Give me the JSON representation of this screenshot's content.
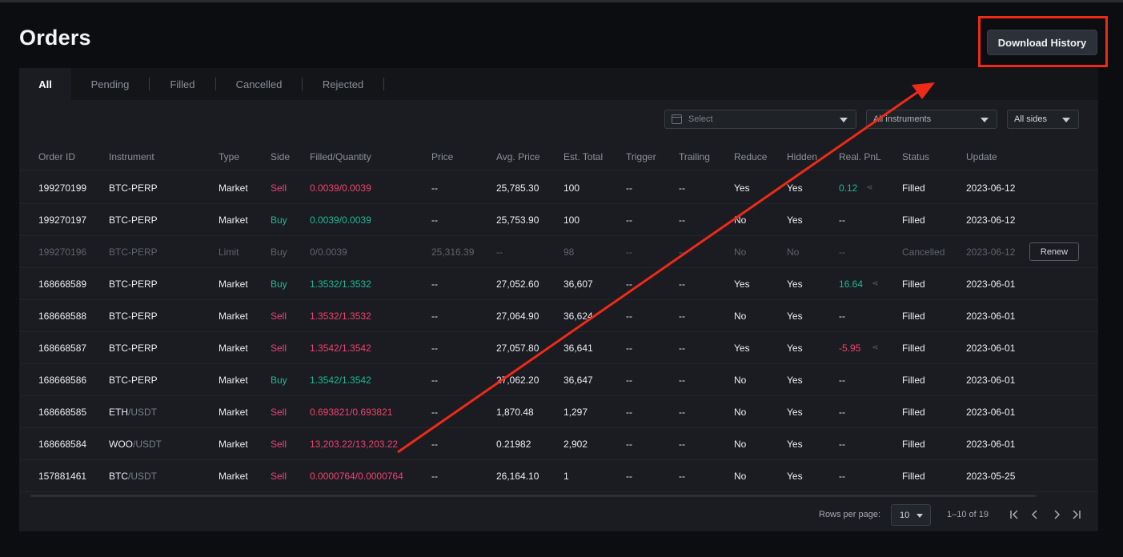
{
  "page": {
    "title": "Orders"
  },
  "header": {
    "download_label": "Download History"
  },
  "tabs": [
    {
      "label": "All",
      "active": true
    },
    {
      "label": "Pending",
      "active": false
    },
    {
      "label": "Filled",
      "active": false
    },
    {
      "label": "Cancelled",
      "active": false
    },
    {
      "label": "Rejected",
      "active": false
    }
  ],
  "filters": {
    "date": {
      "placeholder": "Select",
      "icon": "calendar-icon"
    },
    "instrument": {
      "value": "All instruments"
    },
    "side": {
      "value": "All sides"
    }
  },
  "columns": [
    "Order ID",
    "Instrument",
    "Type",
    "Side",
    "Filled/Quantity",
    "Price",
    "Avg. Price",
    "Est. Total",
    "Trigger",
    "Trailing",
    "Reduce",
    "Hidden",
    "Real. PnL",
    "Status",
    "Update"
  ],
  "rows": [
    {
      "order_id": "199270199",
      "base": "BTC-PERP",
      "quote": "",
      "type": "Market",
      "side": "Sell",
      "filled": "0.0039/0.0039",
      "price": "--",
      "avg_price": "25,785.30",
      "est_total": "100",
      "trigger": "--",
      "trailing": "--",
      "reduce": "Yes",
      "hidden": "Yes",
      "pnl": "0.12",
      "pnl_color": "buy",
      "status": "Filled",
      "update": "2023-06-12",
      "dim": false
    },
    {
      "order_id": "199270197",
      "base": "BTC-PERP",
      "quote": "",
      "type": "Market",
      "side": "Buy",
      "filled": "0.0039/0.0039",
      "price": "--",
      "avg_price": "25,753.90",
      "est_total": "100",
      "trigger": "--",
      "trailing": "--",
      "reduce": "No",
      "hidden": "Yes",
      "pnl": "--",
      "pnl_color": "",
      "status": "Filled",
      "update": "2023-06-12",
      "dim": false
    },
    {
      "order_id": "199270196",
      "base": "BTC-PERP",
      "quote": "",
      "type": "Limit",
      "side": "Buy",
      "filled": "0/0.0039",
      "price": "25,316.39",
      "avg_price": "--",
      "est_total": "98",
      "trigger": "--",
      "trailing": "--",
      "reduce": "No",
      "hidden": "No",
      "pnl": "--",
      "pnl_color": "",
      "status": "Cancelled",
      "update": "2023-06-12",
      "dim": true,
      "action": "Renew"
    },
    {
      "order_id": "168668589",
      "base": "BTC-PERP",
      "quote": "",
      "type": "Market",
      "side": "Buy",
      "filled": "1.3532/1.3532",
      "price": "--",
      "avg_price": "27,052.60",
      "est_total": "36,607",
      "trigger": "--",
      "trailing": "--",
      "reduce": "Yes",
      "hidden": "Yes",
      "pnl": "16.64",
      "pnl_color": "buy",
      "status": "Filled",
      "update": "2023-06-01",
      "dim": false
    },
    {
      "order_id": "168668588",
      "base": "BTC-PERP",
      "quote": "",
      "type": "Market",
      "side": "Sell",
      "filled": "1.3532/1.3532",
      "price": "--",
      "avg_price": "27,064.90",
      "est_total": "36,624",
      "trigger": "--",
      "trailing": "--",
      "reduce": "No",
      "hidden": "Yes",
      "pnl": "--",
      "pnl_color": "",
      "status": "Filled",
      "update": "2023-06-01",
      "dim": false
    },
    {
      "order_id": "168668587",
      "base": "BTC-PERP",
      "quote": "",
      "type": "Market",
      "side": "Sell",
      "filled": "1.3542/1.3542",
      "price": "--",
      "avg_price": "27,057.80",
      "est_total": "36,641",
      "trigger": "--",
      "trailing": "--",
      "reduce": "Yes",
      "hidden": "Yes",
      "pnl": "-5.95",
      "pnl_color": "sell",
      "status": "Filled",
      "update": "2023-06-01",
      "dim": false
    },
    {
      "order_id": "168668586",
      "base": "BTC-PERP",
      "quote": "",
      "type": "Market",
      "side": "Buy",
      "filled": "1.3542/1.3542",
      "price": "--",
      "avg_price": "27,062.20",
      "est_total": "36,647",
      "trigger": "--",
      "trailing": "--",
      "reduce": "No",
      "hidden": "Yes",
      "pnl": "--",
      "pnl_color": "",
      "status": "Filled",
      "update": "2023-06-01",
      "dim": false
    },
    {
      "order_id": "168668585",
      "base": "ETH",
      "quote": "/USDT",
      "type": "Market",
      "side": "Sell",
      "filled": "0.693821/0.693821",
      "price": "--",
      "avg_price": "1,870.48",
      "est_total": "1,297",
      "trigger": "--",
      "trailing": "--",
      "reduce": "No",
      "hidden": "Yes",
      "pnl": "--",
      "pnl_color": "",
      "status": "Filled",
      "update": "2023-06-01",
      "dim": false
    },
    {
      "order_id": "168668584",
      "base": "WOO",
      "quote": "/USDT",
      "type": "Market",
      "side": "Sell",
      "filled": "13,203.22/13,203.22",
      "price": "--",
      "avg_price": "0.21982",
      "est_total": "2,902",
      "trigger": "--",
      "trailing": "--",
      "reduce": "No",
      "hidden": "Yes",
      "pnl": "--",
      "pnl_color": "",
      "status": "Filled",
      "update": "2023-06-01",
      "dim": false
    },
    {
      "order_id": "157881461",
      "base": "BTC",
      "quote": "/USDT",
      "type": "Market",
      "side": "Sell",
      "filled": "0.0000764/0.0000764",
      "price": "--",
      "avg_price": "26,164.10",
      "est_total": "1",
      "trigger": "--",
      "trailing": "--",
      "reduce": "No",
      "hidden": "Yes",
      "pnl": "--",
      "pnl_color": "",
      "status": "Filled",
      "update": "2023-05-25",
      "dim": false
    }
  ],
  "pagination": {
    "rows_per_page_label": "Rows per page:",
    "rows_per_page": "10",
    "range": "1–10 of 19"
  },
  "colors": {
    "sell": "#f0436e",
    "buy": "#1fb896",
    "annotation": "#ee2a18",
    "background": "#0c0d10",
    "panel": "#1a1c21"
  }
}
